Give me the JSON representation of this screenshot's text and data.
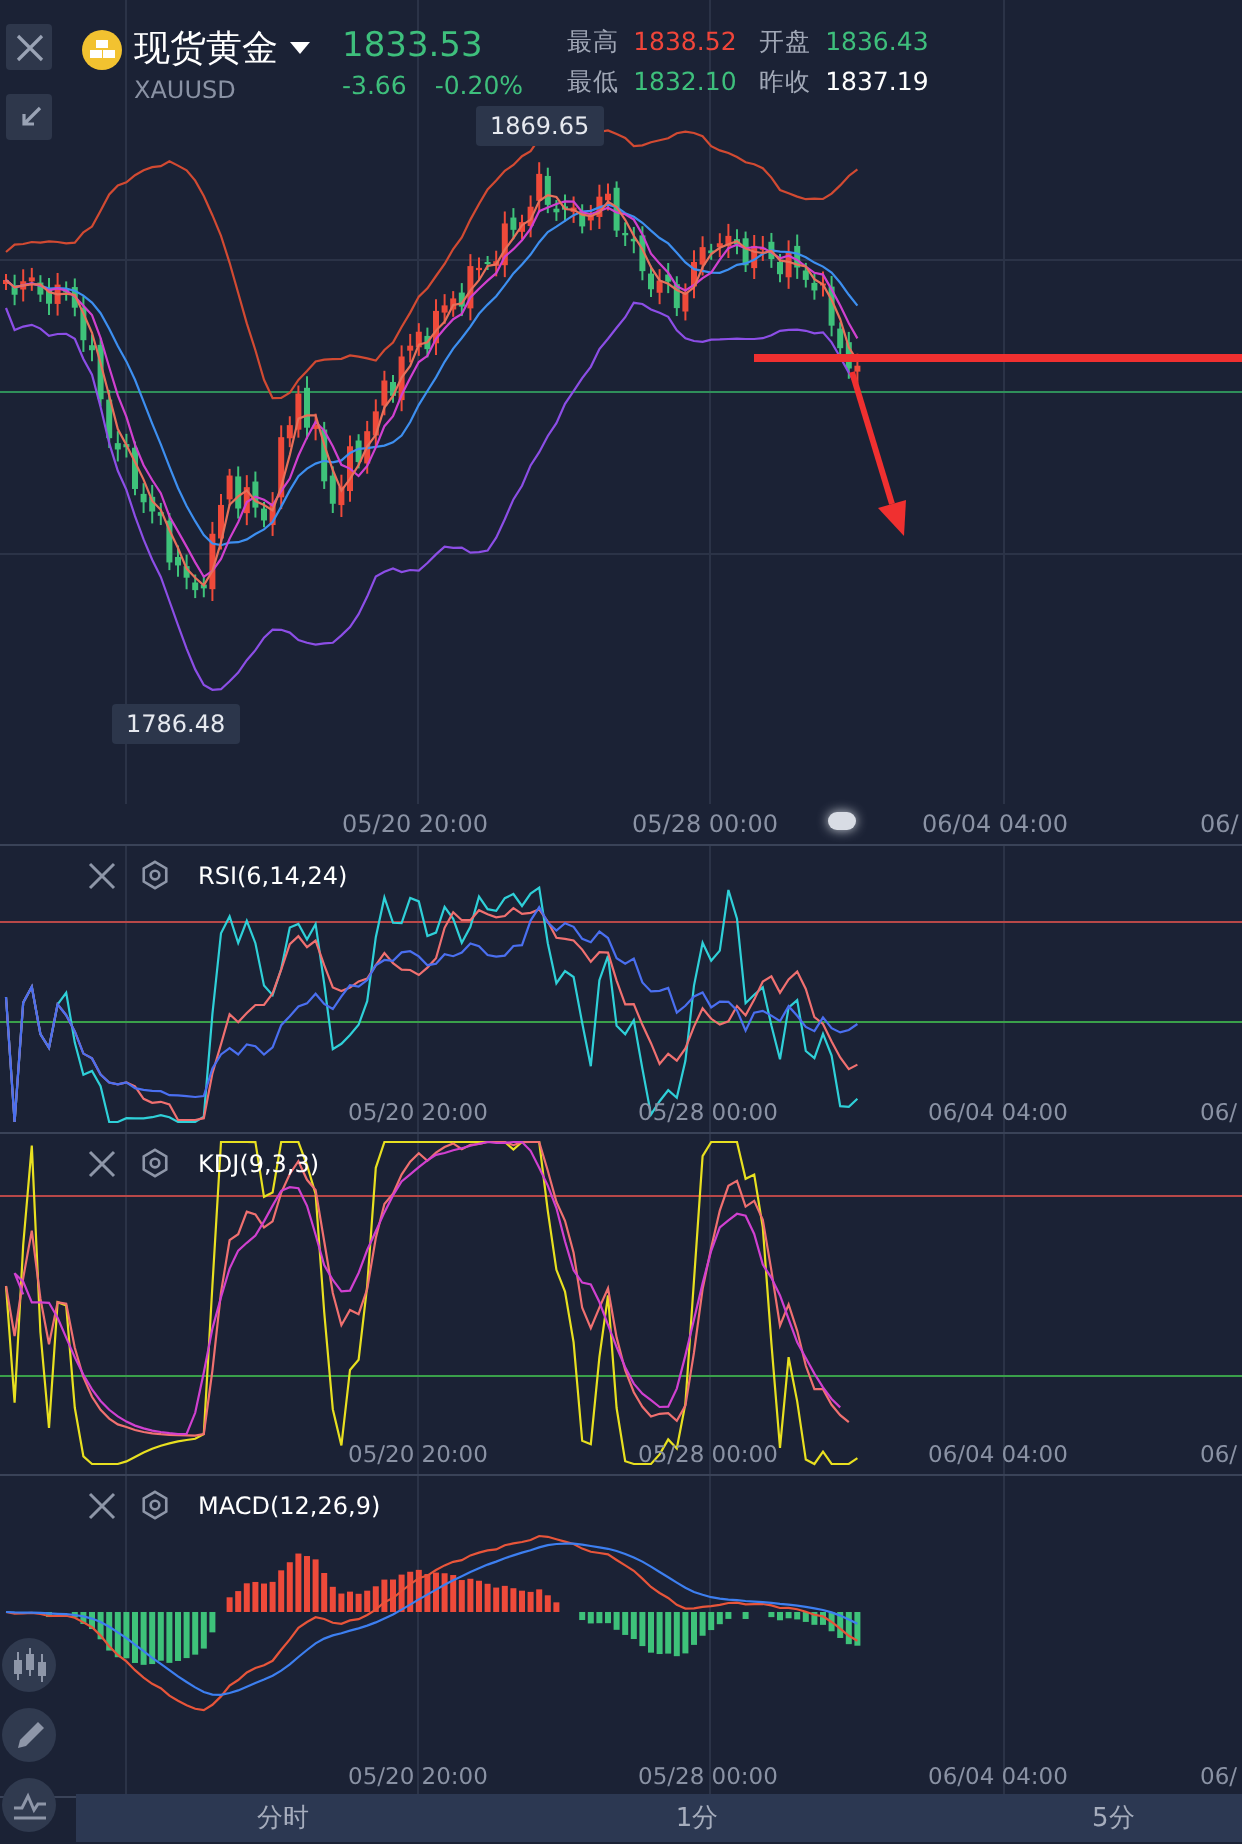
{
  "header": {
    "name": "现货黄金",
    "symbol": "XAUUSD",
    "price": "1833.53",
    "change": "-3.66",
    "change_pct": "-0.20%",
    "stats": [
      {
        "label": "最高",
        "value": "1838.52",
        "color": "#f0453a"
      },
      {
        "label": "开盘",
        "value": "1836.43",
        "color": "#3ebf7c"
      },
      {
        "label": "最低",
        "value": "1832.10",
        "color": "#3ebf7c"
      },
      {
        "label": "昨收",
        "value": "1837.19",
        "color": "#ffffff"
      }
    ]
  },
  "main_chart": {
    "high_label": "1869.65",
    "low_label": "1786.48",
    "time_labels": [
      "05/20 20:00",
      "05/28 00:00",
      "06/04 04:00",
      "06/"
    ]
  },
  "panels": [
    {
      "kind": "rsi",
      "title": "RSI(6,14,24)",
      "time_labels": [
        "05/20 20:00",
        "05/28 00:00",
        "06/04 04:00",
        "06/"
      ]
    },
    {
      "kind": "kdj",
      "title": "KDJ(9,3,3)",
      "time_labels": [
        "05/20 20:00",
        "05/28 00:00",
        "06/04 04:00",
        "06/"
      ]
    },
    {
      "kind": "macd",
      "title": "MACD(12,26,9)",
      "time_labels": [
        "05/20 20:00",
        "05/28 00:00",
        "06/04 04:00",
        "06/"
      ]
    }
  ],
  "periods": [
    {
      "label": "分时"
    },
    {
      "label": "1分"
    },
    {
      "label": "5分"
    }
  ]
}
